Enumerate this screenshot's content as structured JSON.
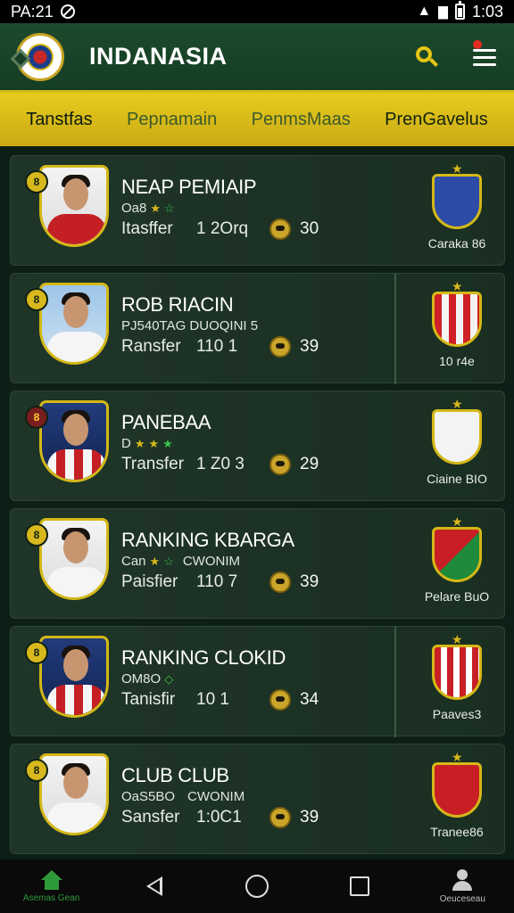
{
  "status": {
    "time": "PA:21",
    "clock": "1:03"
  },
  "header": {
    "title": "INDANASIA"
  },
  "tabs": [
    {
      "label": "Tanstfas"
    },
    {
      "label": "Pepnamain"
    },
    {
      "label": "PenmsMaas"
    },
    {
      "label": "PrenGavelus"
    }
  ],
  "cards": [
    {
      "name": "NEAP PEMIAIP",
      "sub": "Oa8",
      "transfer_label": "Itasffer",
      "transfer_value": "1 2Orq",
      "count": "30",
      "club": "Caraka 86",
      "rank": "8"
    },
    {
      "name": "ROB RIACIN",
      "sub": "PJ540TAG DUOQINI 5",
      "transfer_label": "Ransfer",
      "transfer_value": "110 1",
      "count": "39",
      "club": "10 r4e",
      "rank": "8"
    },
    {
      "name": "PANEBAA",
      "sub": "D",
      "transfer_label": "Transfer",
      "transfer_value": "1 Z0 3",
      "count": "29",
      "club": "Ciaine BIO",
      "rank": "8"
    },
    {
      "name": "RANKING KBARGA",
      "sub": "Can",
      "sub2": "CWONIM",
      "transfer_label": "Paisfier",
      "transfer_value": "110 7",
      "count": "39",
      "club": "Pelare BuO",
      "rank": "8"
    },
    {
      "name": "RANKING CLOKID",
      "sub": "OM8O",
      "transfer_label": "Tanisfir",
      "transfer_value": "10 1",
      "count": "34",
      "club": "Paaves3",
      "rank": "8"
    },
    {
      "name": "CLUB CLUB",
      "sub": "OaS5BO",
      "sub2": "CWONIM",
      "transfer_label": "Sansfer",
      "transfer_value": "1:0C1",
      "count": "39",
      "club": "Tranee86",
      "rank": "8"
    }
  ],
  "nav": {
    "home_label": "Asemas Gean",
    "profile_label": "Oeuceseau"
  }
}
